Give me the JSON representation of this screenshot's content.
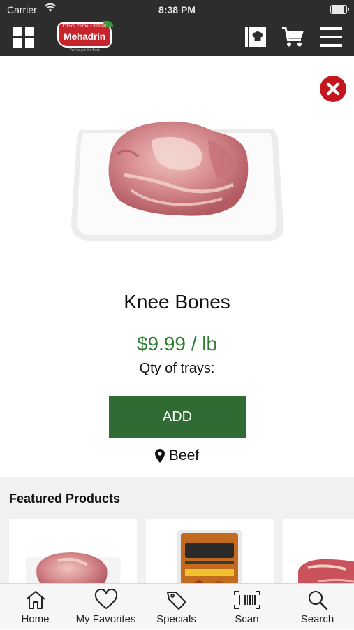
{
  "status_bar": {
    "carrier": "Carrier",
    "time": "8:38 PM",
    "battery_level": 0.9
  },
  "header": {
    "logo": {
      "name": "Mehadrin",
      "tagline_top": "Cholov Yisroel • Kosher",
      "tagline_bottom": "You've got the Best"
    },
    "icons": [
      "grid-icon",
      "cookbook-icon",
      "cart-icon",
      "menu-icon"
    ]
  },
  "product": {
    "name": "Knee Bones",
    "price": "$9.99 / lb",
    "qty_label": "Qty of trays:",
    "add_label": "ADD",
    "category": "Beef"
  },
  "featured": {
    "title": "Featured Products"
  },
  "tabs": [
    {
      "label": "Home",
      "icon": "home-icon"
    },
    {
      "label": "My Favorites",
      "icon": "heart-icon"
    },
    {
      "label": "Specials",
      "icon": "tag-icon"
    },
    {
      "label": "Scan",
      "icon": "barcode-icon"
    },
    {
      "label": "Search",
      "icon": "search-icon"
    }
  ],
  "colors": {
    "brand_red": "#c4161c",
    "accent_green": "#2f6b33",
    "price_green": "#2e7d32",
    "header_dark": "#2d2d2d"
  }
}
